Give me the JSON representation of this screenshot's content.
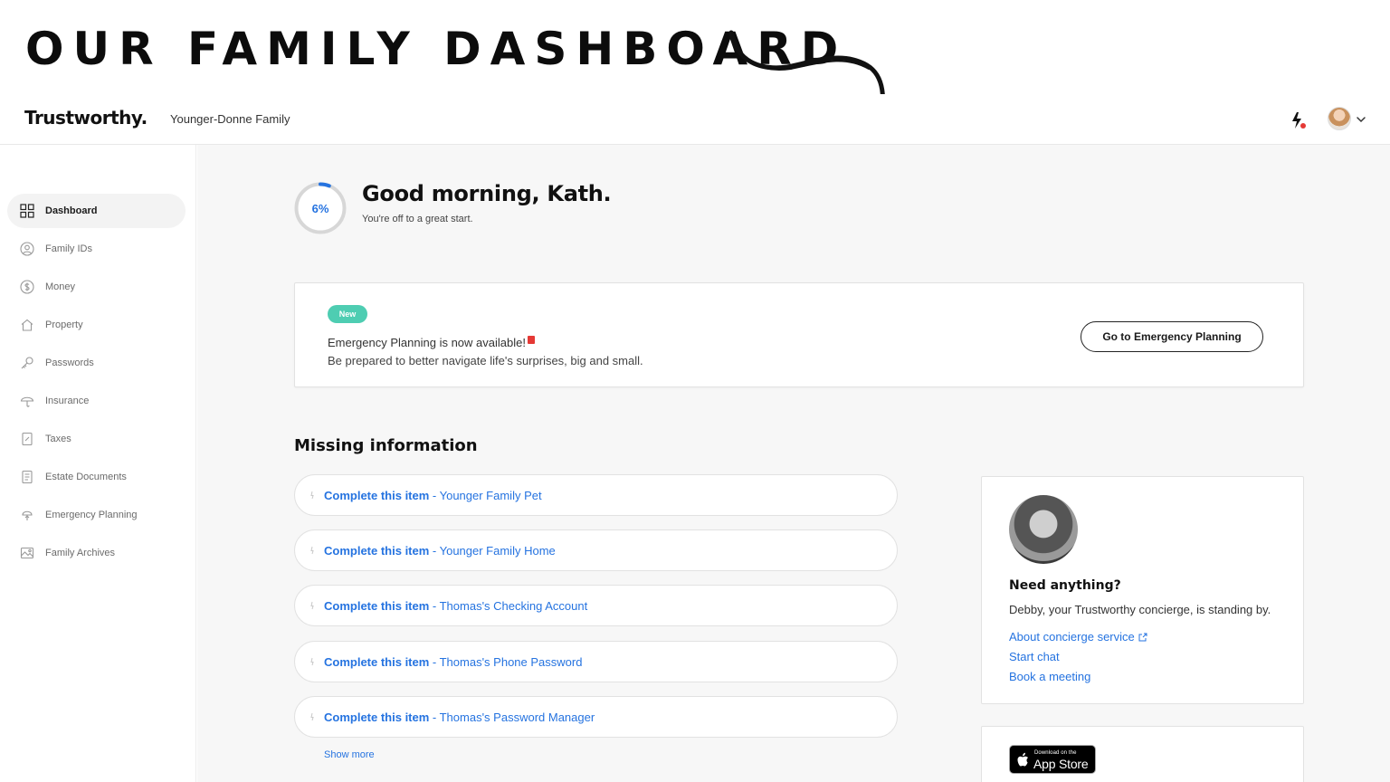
{
  "banner": {
    "title": "OUR FAMILY DASHBOARD"
  },
  "header": {
    "logo": "Trustworthy.",
    "family_name": "Younger-Donne Family",
    "icons": {
      "activity": "bolt-icon",
      "account": "avatar",
      "menu": "chevron-down-icon"
    }
  },
  "sidebar": {
    "items": [
      {
        "label": "Dashboard",
        "icon": "grid-icon",
        "active": true
      },
      {
        "label": "Family IDs",
        "icon": "person-icon",
        "active": false
      },
      {
        "label": "Money",
        "icon": "dollar-icon",
        "active": false
      },
      {
        "label": "Property",
        "icon": "home-icon",
        "active": false
      },
      {
        "label": "Passwords",
        "icon": "key-icon",
        "active": false
      },
      {
        "label": "Insurance",
        "icon": "umbrella-icon",
        "active": false
      },
      {
        "label": "Taxes",
        "icon": "tax-doc-icon",
        "active": false
      },
      {
        "label": "Estate Documents",
        "icon": "document-icon",
        "active": false
      },
      {
        "label": "Emergency Planning",
        "icon": "emergency-icon",
        "active": false
      },
      {
        "label": "Family Archives",
        "icon": "image-icon",
        "active": false
      }
    ]
  },
  "greeting": {
    "progress_label": "6%",
    "progress_value": 0.06,
    "title": "Good morning, Kath.",
    "subtitle": "You're off to a great start."
  },
  "promo": {
    "badge": "New",
    "line1": "Emergency Planning is now available!",
    "line2": "Be prepared to better navigate life's surprises, big and small.",
    "button": "Go to Emergency Planning"
  },
  "missing": {
    "title": "Missing information",
    "prefix": "Complete this item",
    "items": [
      " - Younger Family Pet",
      " - Younger Family Home",
      " - Thomas's Checking Account",
      " - Thomas's Phone Password",
      " - Thomas's Password Manager"
    ],
    "show_more": "Show more"
  },
  "concierge": {
    "title": "Need anything?",
    "subtitle": "Debby, your Trustworthy concierge, is standing by.",
    "links": [
      "About concierge service",
      "Start chat",
      "Book a meeting"
    ]
  },
  "app_store": {
    "small": "Download on the",
    "big": "App Store"
  },
  "colors": {
    "accent": "#2573e0",
    "badge": "#4ecdb2",
    "alert": "#e53935"
  }
}
